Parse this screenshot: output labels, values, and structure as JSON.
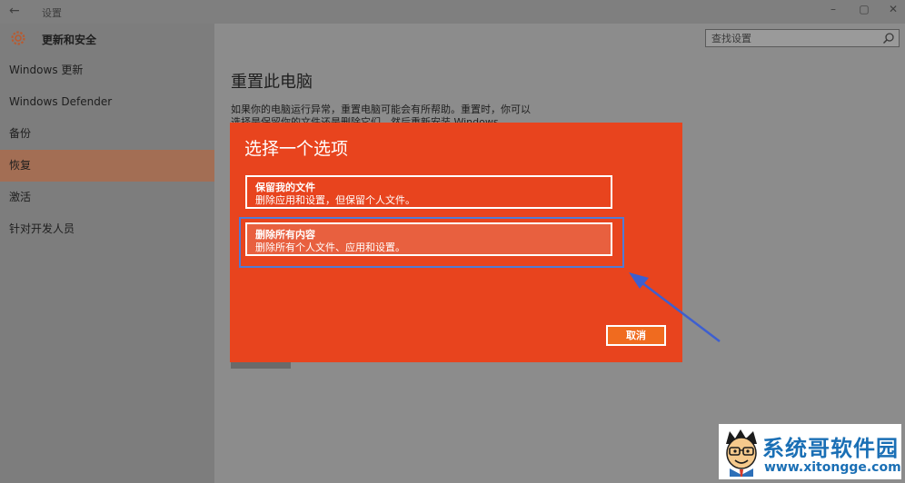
{
  "window": {
    "title": "设置",
    "back_icon": "back-arrow-icon",
    "controls": [
      "minimize-icon",
      "maximize-icon",
      "close-icon"
    ]
  },
  "search": {
    "placeholder": "查找设置",
    "icon": "search-icon"
  },
  "sidebar": {
    "header": {
      "icon": "gear-icon",
      "label": "更新和安全"
    },
    "items": [
      {
        "label": "Windows 更新",
        "active": false
      },
      {
        "label": "Windows Defender",
        "active": false
      },
      {
        "label": "备份",
        "active": false
      },
      {
        "label": "恢复",
        "active": true
      },
      {
        "label": "激活",
        "active": false
      },
      {
        "label": "针对开发人员",
        "active": false
      }
    ]
  },
  "main": {
    "title": "重置此电脑",
    "description": "如果你的电脑运行异常，重置电脑可能会有所帮助。重置时，你可以选择是保留你的文件还是删除它们，然后重新安装 Windows。"
  },
  "dialog": {
    "title": "选择一个选项",
    "options": [
      {
        "title": "保留我的文件",
        "desc": "删除应用和设置，但保留个人文件。"
      },
      {
        "title": "删除所有内容",
        "desc": "删除所有个人文件、应用和设置。"
      }
    ],
    "cancel_label": "取消"
  },
  "watermark": {
    "name": "系统哥软件园",
    "url": "www.xitongge.com"
  },
  "colors": {
    "dialog_bg": "#e8441e",
    "highlight": "#4f7bd6",
    "active_item": "#a36e54"
  }
}
